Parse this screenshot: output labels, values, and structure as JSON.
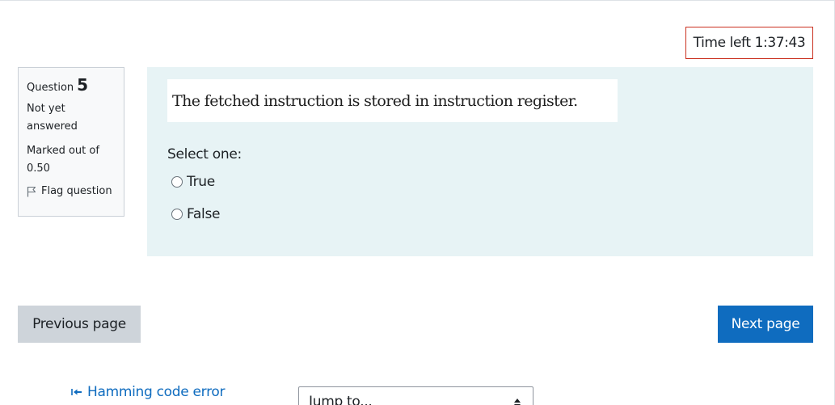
{
  "timer": {
    "label": "Time left",
    "value": "1:37:43"
  },
  "question_info": {
    "label": "Question",
    "number": "5",
    "state": "Not yet answered",
    "grade": "Marked out of 0.50",
    "flag_label": "Flag question",
    "icons": {
      "flag": "flag-icon"
    }
  },
  "question": {
    "text": "The fetched instruction is stored in instruction register.",
    "prompt": "Select one:",
    "options": [
      {
        "label": "True",
        "selected": false
      },
      {
        "label": "False",
        "selected": false
      }
    ]
  },
  "navigation": {
    "previous_label": "Previous page",
    "next_label": "Next page"
  },
  "activity_nav": {
    "previous_activity": "Hamming code error",
    "previous_icon": "arrow-left-icon",
    "jump_placeholder": "Jump to..."
  },
  "colors": {
    "timer_border": "#ca3120",
    "question_background": "#e7f3f5",
    "primary": "#0f6cbf",
    "secondary": "#ced4da"
  }
}
